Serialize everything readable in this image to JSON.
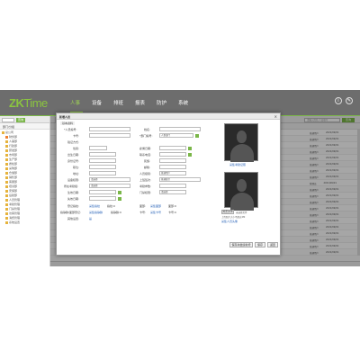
{
  "app": {
    "logo_zk": "ZK",
    "logo_time": "Time",
    "nav": [
      "人事",
      "设备",
      "排班",
      "报表",
      "防护",
      "系统"
    ],
    "active_nav": "人事",
    "icons": [
      "info-icon",
      "edit-icon"
    ]
  },
  "sidebar": {
    "filter_button": "查询",
    "header": "部门/分组",
    "tree": [
      "总公司",
      "财务部",
      "人事部",
      "行政部",
      "研发部",
      "市场部",
      "生产部",
      "质检部",
      "采购部",
      "仓储部",
      "销售部",
      "客服部",
      "培训部",
      "安保部",
      "后勤部",
      "人员管理",
      "考勤管理",
      "门禁管理",
      "访客管理",
      "消费管理",
      "系统设置"
    ]
  },
  "main": {
    "tab_label": "人事编号",
    "search_placeholder": "请输入姓名,人员编号",
    "search_button": "查询",
    "rows": [
      {
        "num": "1",
        "cells": [
          "普通用户",
          "2021/09/01"
        ]
      },
      {
        "num": "2",
        "cells": [
          "普通用户",
          "2021/09/01"
        ]
      },
      {
        "num": "3",
        "cells": [
          "普通用户",
          "2021/09/01"
        ]
      },
      {
        "num": "4",
        "cells": [
          "普通用户",
          "2021/09/01"
        ]
      },
      {
        "num": "5",
        "cells": [
          "普通用户",
          "2021/09/01"
        ]
      },
      {
        "num": "6",
        "cells": [
          "普通用户",
          "2021/09/01"
        ]
      },
      {
        "num": "7",
        "cells": [
          "普通用户",
          "2021/09/01"
        ]
      },
      {
        "num": "8",
        "cells": [
          "普通用户",
          "2021/09/01"
        ]
      },
      {
        "num": "9",
        "cells": [
          "管理员",
          "2021/09/01"
        ]
      },
      {
        "num": "10",
        "cells": [
          "普通用户",
          "2021/09/01"
        ]
      },
      {
        "num": "11",
        "cells": [
          "普通用户",
          "2021/09/01"
        ]
      },
      {
        "num": "12",
        "cells": [
          "普通用户",
          "2021/09/01"
        ]
      },
      {
        "num": "13",
        "cells": [
          "普通用户",
          "2021/09/01"
        ]
      },
      {
        "num": "14",
        "cells": [
          "普通用户",
          "2021/09/01"
        ]
      },
      {
        "num": "15",
        "cells": [
          "普通用户",
          "2021/09/01"
        ]
      },
      {
        "num": "16",
        "cells": [
          "普通用户",
          "2021/09/01"
        ]
      },
      {
        "num": "17",
        "cells": [
          "普通用户",
          "2021/09/01"
        ]
      },
      {
        "num": "18",
        "cells": [
          "普通用户",
          "2021/09/01"
        ]
      },
      {
        "num": "19",
        "cells": [
          "普通用户",
          "2021/09/01"
        ]
      },
      {
        "num": "20",
        "cells": [
          "普通用户",
          "2021/09/01"
        ]
      }
    ]
  },
  "modal": {
    "title": "新增人员",
    "tab": "基本资料",
    "fields": {
      "id_label": "*人员编号:",
      "name_label": "姓名:",
      "card_label": "卡号:",
      "dept_label": "*部门编号:",
      "dept_value": "人事部门",
      "verify_label": "验证方式:",
      "gender_label": "性别:",
      "hire_label": "雇佣日期:",
      "birth_label": "出生日期:",
      "phone_label": "联系电话:",
      "idcard_label": "身份证号:",
      "nation_label": "民族:",
      "title_label": "职位:",
      "email_label": "邮箱:",
      "address_label": "地址:",
      "level_label": "人员级别:",
      "level_value": "普通用户",
      "device_label": "设备权限:",
      "device_value": "请选择",
      "shift_label": "上班班次:",
      "shift_value": "普通班次",
      "group_label": "所在考勤组:",
      "group_value": "请选择",
      "att_label": "考勤参数:",
      "start_label": "生效日期:",
      "end_label": "失效日期:",
      "door_label": "门禁权限:",
      "door_value": "请选择"
    },
    "links": {
      "fingerprint_label": "登记指纹:",
      "fingerprint": "采集指纹",
      "fingerprint_count": "指纹:0",
      "face_label": "面部:",
      "face": "采集面部",
      "face_count": "面部:0",
      "palm_label": "指静脉/面部登记:",
      "palm": "采集指静脉",
      "palm_count": "指静脉:0",
      "card_label": "卡号:",
      "card": "采集卡号",
      "card_count": "卡号:0",
      "other_label": "其他设置:",
      "other_value": "是"
    },
    "photo1_caption": "采集考勤证照",
    "photo2_button": "浏览文件",
    "photo2_hint": "未选择文件",
    "photo2_note": "上传照片大小不超过2M",
    "photo2_caption": "采集人员头像",
    "buttons": {
      "save_continue": "保存并继续新增",
      "save": "保存",
      "cancel": "返回"
    }
  }
}
